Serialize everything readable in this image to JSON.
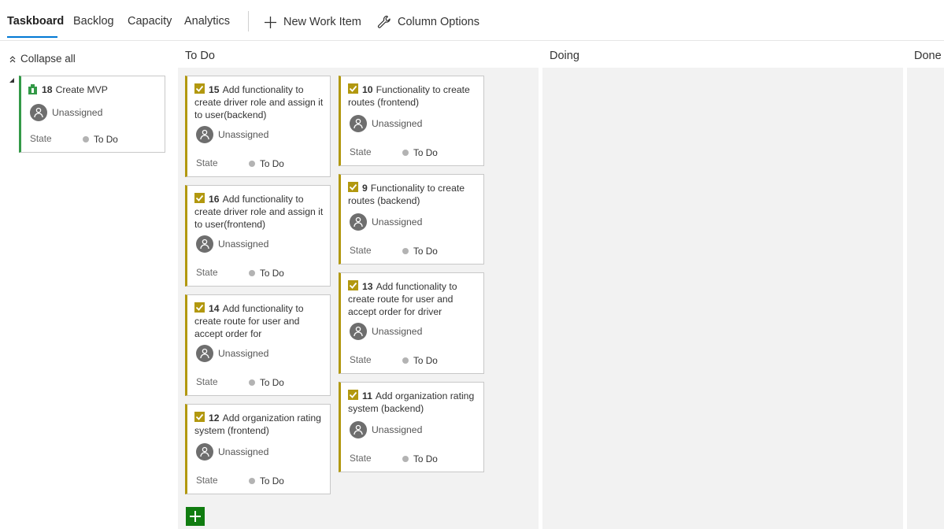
{
  "nav": {
    "tabs": [
      {
        "label": "Taskboard",
        "active": true
      },
      {
        "label": "Backlog"
      },
      {
        "label": "Capacity"
      },
      {
        "label": "Analytics"
      }
    ],
    "new_work_item": "New Work Item",
    "column_options": "Column Options"
  },
  "board": {
    "collapse_all": "Collapse all",
    "columns": [
      "To Do",
      "Doing",
      "Done"
    ],
    "parent": {
      "id": "18",
      "title": "Create MVP",
      "assignee": "Unassigned",
      "state_label": "State",
      "state": "To Do",
      "icon": "trophy-icon"
    },
    "cards": [
      {
        "id": "15",
        "title": "Add functionality to create driver role and assign it to user(backend)",
        "assignee": "Unassigned",
        "state_label": "State",
        "state": "To Do"
      },
      {
        "id": "16",
        "title": "Add functionality to create driver role and assign it to user(frontend)",
        "assignee": "Unassigned",
        "state_label": "State",
        "state": "To Do"
      },
      {
        "id": "14",
        "title": "Add functionality to create route for user and accept order for",
        "assignee": "Unassigned",
        "state_label": "State",
        "state": "To Do"
      },
      {
        "id": "12",
        "title": "Add organization rating system (frontend)",
        "assignee": "Unassigned",
        "state_label": "State",
        "state": "To Do"
      },
      {
        "id": "10",
        "title": "Functionality to create routes (frontend)",
        "assignee": "Unassigned",
        "state_label": "State",
        "state": "To Do"
      },
      {
        "id": "9",
        "title": "Functionality to create routes (backend)",
        "assignee": "Unassigned",
        "state_label": "State",
        "state": "To Do"
      },
      {
        "id": "13",
        "title": "Add functionality to create route for user and accept order for driver",
        "assignee": "Unassigned",
        "state_label": "State",
        "state": "To Do"
      },
      {
        "id": "11",
        "title": "Add organization rating system (backend)",
        "assignee": "Unassigned",
        "state_label": "State",
        "state": "To Do"
      }
    ]
  },
  "colors": {
    "accent": "#0078d4",
    "task": "#b2980f",
    "pbi": "#339947",
    "add_button": "#107c10",
    "lane": "#f2f2f2"
  }
}
